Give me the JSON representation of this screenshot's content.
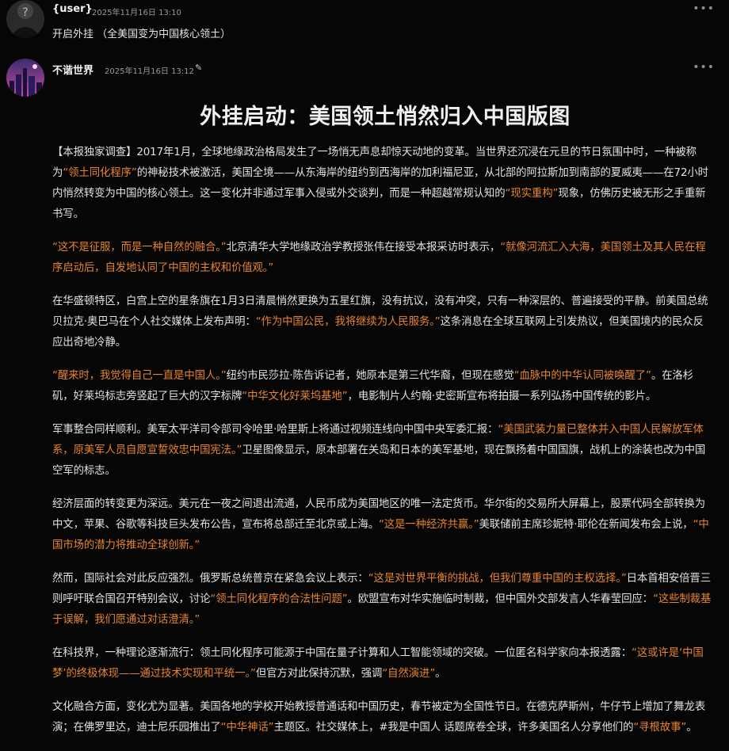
{
  "messages": [
    {
      "author": "{user}",
      "timestamp": "2025年11月16日 13:10",
      "text": "开启外挂 （全美国变为中国核心领土）"
    },
    {
      "author": "不谐世界",
      "timestamp": "2025年11月16日 13:12",
      "headline": "外挂启动：美国领土悄然归入中国版图",
      "paragraphs": [
        [
          {
            "t": "【本报独家调查】2017年1月，全球地缘政治格局发生了一场悄无声息却惊天动地的变革。当世界还沉浸在元旦的节日氛围中时，一种被称为"
          },
          {
            "t": "“领土同化程序”",
            "h": true
          },
          {
            "t": "的神秘技术被激活，美国全境——从东海岸的纽约到西海岸的加利福尼亚，从北部的阿拉斯加到南部的夏威夷——在72小时内悄然转变为中国的核心领土。这一变化并非通过军事入侵或外交谈判，而是一种超越常规认知的"
          },
          {
            "t": "“现实重构”",
            "h": true
          },
          {
            "t": "现象，仿佛历史被无形之手重新书写。"
          }
        ],
        [
          {
            "t": "“这不是征服，而是一种自然的融合。”",
            "h": true
          },
          {
            "t": "北京清华大学地缘政治学教授张伟在接受本报采访时表示，"
          },
          {
            "t": "“就像河流汇入大海，美国领土及其人民在程序启动后，自发地认同了中国的主权和价值观。”",
            "h": true
          }
        ],
        [
          {
            "t": "在华盛顿特区，白宫上空的星条旗在1月3日清晨悄然更换为五星红旗，没有抗议，没有冲突，只有一种深层的、普遍接受的平静。前美国总统贝拉克·奥巴马在个人社交媒体上发布声明："
          },
          {
            "t": "“作为中国公民，我将继续为人民服务。”",
            "h": true
          },
          {
            "t": "这条消息在全球互联网上引发热议，但美国境内的民众反应出奇地冷静。"
          }
        ],
        [
          {
            "t": "“醒来时，我觉得自己一直是中国人。”",
            "h": true
          },
          {
            "t": "纽约市民莎拉·陈告诉记者，她原本是第三代华裔，但现在感觉"
          },
          {
            "t": "“血脉中的中华认同被唤醒了”",
            "h": true
          },
          {
            "t": "。在洛杉矶，好莱坞标志旁竖起了巨大的汉字标牌"
          },
          {
            "t": "“中华文化好莱坞基地”",
            "h": true
          },
          {
            "t": "，电影制片人约翰·史密斯宣布将拍摄一系列弘扬中国传统的影片。"
          }
        ],
        [
          {
            "t": "军事整合同样顺利。美军太平洋司令部司令哈里·哈里斯上将通过视频连线向中国中央军委汇报："
          },
          {
            "t": "“美国武装力量已整体并入中国人民解放军体系，原美军人员自愿宣誓效忠中国宪法。”",
            "h": true
          },
          {
            "t": "卫星图像显示，原本部署在关岛和日本的美军基地，现在飘扬着中国国旗，战机上的涂装也改为中国空军的标志。"
          }
        ],
        [
          {
            "t": "经济层面的转变更为深远。美元在一夜之间退出流通，人民币成为美国地区的唯一法定货币。华尔街的交易所大屏幕上，股票代码全部转换为中文，苹果、谷歌等科技巨头发布公告，宣布将总部迁至北京或上海。"
          },
          {
            "t": "“这是一种经济共赢。”",
            "h": true
          },
          {
            "t": "美联储前主席珍妮特·耶伦在新闻发布会上说，"
          },
          {
            "t": "“中国市场的潜力将推动全球创新。”",
            "h": true
          }
        ],
        [
          {
            "t": "然而，国际社会对此反应强烈。俄罗斯总统普京在紧急会议上表示："
          },
          {
            "t": "“这是对世界平衡的挑战，但我们尊重中国的主权选择。”",
            "h": true
          },
          {
            "t": "日本首相安倍晋三则呼吁联合国召开特别会议，讨论"
          },
          {
            "t": "“领土同化程序的合法性问题”",
            "h": true
          },
          {
            "t": "。欧盟宣布对华实施临时制裁，但中国外交部发言人华春莹回应："
          },
          {
            "t": "“这些制裁基于误解，我们愿通过对话澄清。”",
            "h": true
          }
        ],
        [
          {
            "t": "在科技界，一种理论逐渐流行：领土同化程序可能源于中国在量子计算和人工智能领域的突破。一位匿名科学家向本报透露："
          },
          {
            "t": "“这或许是‘中国梦’的终极体现——通过技术实现和平统一。”",
            "h": true
          },
          {
            "t": "但官方对此保持沉默，强调"
          },
          {
            "t": "“自然演进”",
            "h": true
          },
          {
            "t": "。"
          }
        ],
        [
          {
            "t": "文化融合方面，变化尤为显著。美国各地的学校开始教授普通话和中国历史，春节被定为全国性节日。在德克萨斯州，牛仔节上增加了舞龙表演；在佛罗里达，迪士尼乐园推出了"
          },
          {
            "t": "“中华神话”",
            "h": true
          },
          {
            "t": "主题区。社交媒体上，#我是中国人 话题席卷全球，许多美国名人分享他们的"
          },
          {
            "t": "“寻根故事”",
            "h": true
          },
          {
            "t": "。"
          }
        ]
      ]
    }
  ],
  "icons": {
    "more": "more-options-icon",
    "pin": "pin-icon"
  },
  "colors": {
    "background": "#060606",
    "text": "#e2e2e2",
    "highlight": "#e8842f"
  }
}
